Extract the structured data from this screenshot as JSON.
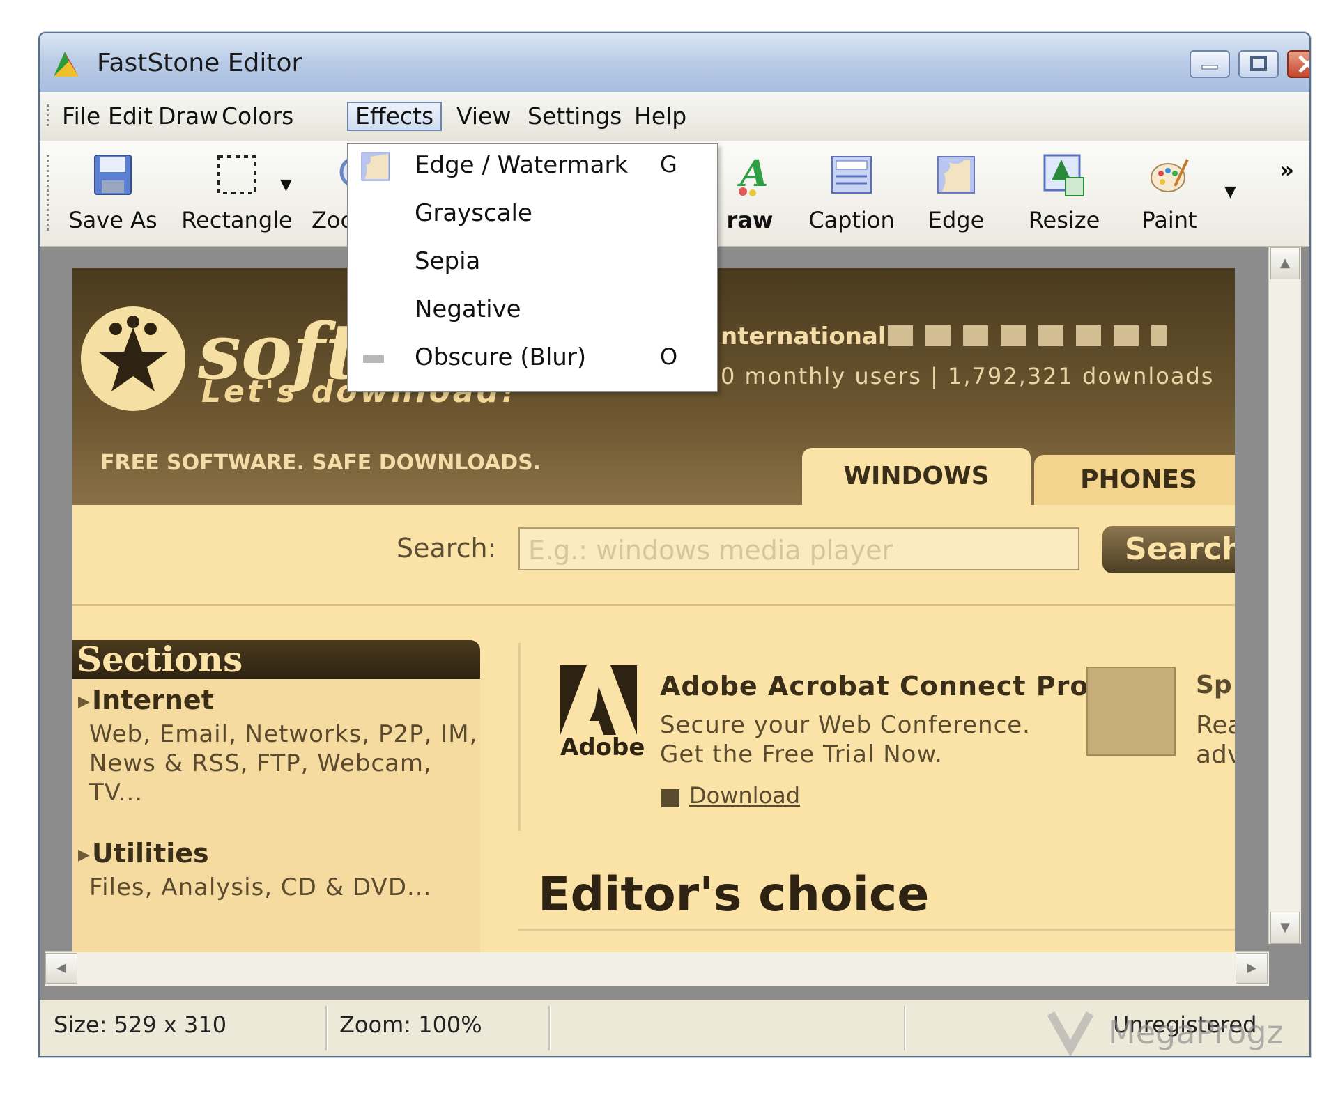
{
  "window": {
    "title": "FastStone Editor"
  },
  "menubar": {
    "items": [
      "File",
      "Edit",
      "Draw",
      "Colors",
      "Effects",
      "View",
      "Settings",
      "Help"
    ],
    "active": "Effects"
  },
  "toolbar": {
    "save_as": "Save As",
    "rectangle": "Rectangle",
    "zoom": "Zoc",
    "draw": "raw",
    "caption": "Caption",
    "edge": "Edge",
    "resize": "Resize",
    "paint": "Paint",
    "overflow": "»"
  },
  "effects_menu": [
    {
      "label": "Edge / Watermark",
      "shortcut": "G",
      "icon": "edge-watermark-icon"
    },
    {
      "label": "Grayscale",
      "shortcut": ""
    },
    {
      "label": "Sepia",
      "shortcut": ""
    },
    {
      "label": "Negative",
      "shortcut": ""
    },
    {
      "label": "Obscure (Blur)",
      "shortcut": "O",
      "icon": "blur-icon"
    }
  ],
  "webpage": {
    "logo_word": "soft",
    "logo_tagline": "Let's download!",
    "international": "nternational",
    "stats": "0 monthly users  |  1,792,321 downloads",
    "slogan": "FREE SOFTWARE. SAFE DOWNLOADS.",
    "tab_windows": "WINDOWS",
    "tab_phones": "PHONES",
    "search_label": "Search:",
    "search_placeholder": "E.g.: windows media player",
    "search_button": "Search",
    "sections_title": "Sections",
    "section_internet": "Internet",
    "section_internet_text": "Web, Email, Networks, P2P, IM, News & RSS, FTP, Webcam, TV...",
    "section_utilities": "Utilities",
    "section_utilities_text": "Files, Analysis, CD & DVD...",
    "adobe_word": "Adobe",
    "promo_title": "Adobe Acrobat Connect Pro",
    "promo_line1": "Secure your Web Conference.",
    "promo_line2": "Get the Free Trial Now.",
    "promo_link": "Download",
    "promo2_t1": "Sp",
    "promo2_t2": "Rea",
    "promo2_t3": "adv",
    "editors_choice": "Editor's choice"
  },
  "status": {
    "size": "Size: 529 x 310",
    "zoom": "Zoom: 100%",
    "registration": "Unregistered"
  },
  "watermark": {
    "text": "MegaProgz"
  },
  "colors": {
    "titlebar": "#b8cbe6",
    "sepia_bg": "#fbe3a8",
    "sepia_dark": "#4a3a1e"
  }
}
